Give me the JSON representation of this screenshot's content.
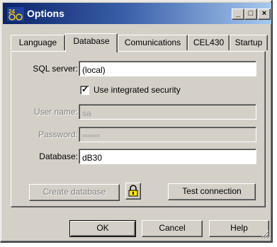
{
  "window": {
    "title": "Options",
    "minimize": "_",
    "maximize": "□",
    "close": "×"
  },
  "tabs": [
    {
      "label": "Language"
    },
    {
      "label": "Database"
    },
    {
      "label": "Comunications"
    },
    {
      "label": "CEL430"
    },
    {
      "label": "Startup"
    }
  ],
  "form": {
    "sql_server_label": "SQL server:",
    "sql_server_value": "(local)",
    "integrated_security_label": "Use integrated security",
    "integrated_security_checked": true,
    "username_label": "User name:",
    "username_value": "sa",
    "password_label": "Password:",
    "password_value": "xxxxxxx",
    "database_label": "Database:",
    "database_value": "dB30"
  },
  "actions": {
    "create_database": "Create database",
    "test_connection": "Test connection"
  },
  "footer": {
    "ok": "OK",
    "cancel": "Cancel",
    "help": "Help"
  },
  "icons": {
    "app_icon": "app-icon",
    "lock": "padlock-icon"
  }
}
